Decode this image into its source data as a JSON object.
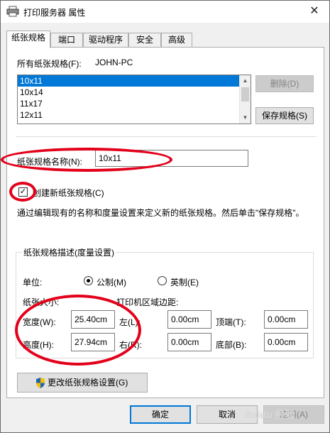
{
  "title": "打印服务器 属性",
  "close_glyph": "✕",
  "tabs": [
    "纸张规格",
    "端口",
    "驱动程序",
    "安全",
    "高级"
  ],
  "forms": {
    "all_forms_label": "所有纸张规格(F):",
    "computer_name": "JOHN-PC",
    "items": [
      "10x11",
      "10x14",
      "11x17",
      "12x11"
    ],
    "delete_label": "删除(D)",
    "save_label": "保存规格(S)",
    "form_name_label": "纸张规格名称(N):",
    "form_name_value": "10x11",
    "create_label": "创建新纸张规格(C)",
    "description": "通过编辑现有的名称和度量设置来定义新的纸张规格。然后单击\"保存规格\"。"
  },
  "measure": {
    "group_title": "纸张规格描述(度量设置)",
    "units_label": "单位:",
    "metric_label": "公制(M)",
    "english_label": "英制(E)",
    "paper_size_label": "纸张大小:",
    "printer_margin_label": "打印机区域边距:",
    "width_label": "宽度(W):",
    "width_value": "25.40cm",
    "height_label": "高度(H):",
    "height_value": "27.94cm",
    "left_label": "左(L):",
    "left_value": "0.00cm",
    "right_label": "右(R):",
    "right_value": "0.00cm",
    "top_label": "顶端(T):",
    "top_value": "0.00cm",
    "bottom_label": "底部(B):",
    "bottom_value": "0.00cm"
  },
  "change_settings_label": "更改纸张规格设置(G)",
  "footer": {
    "ok_label": "确定",
    "cancel_label": "取消",
    "apply_label": "应用(A)"
  },
  "watermark": "Baidu 经验",
  "colors": {
    "selection": "#0078d7",
    "annotation": "#e3001a"
  }
}
